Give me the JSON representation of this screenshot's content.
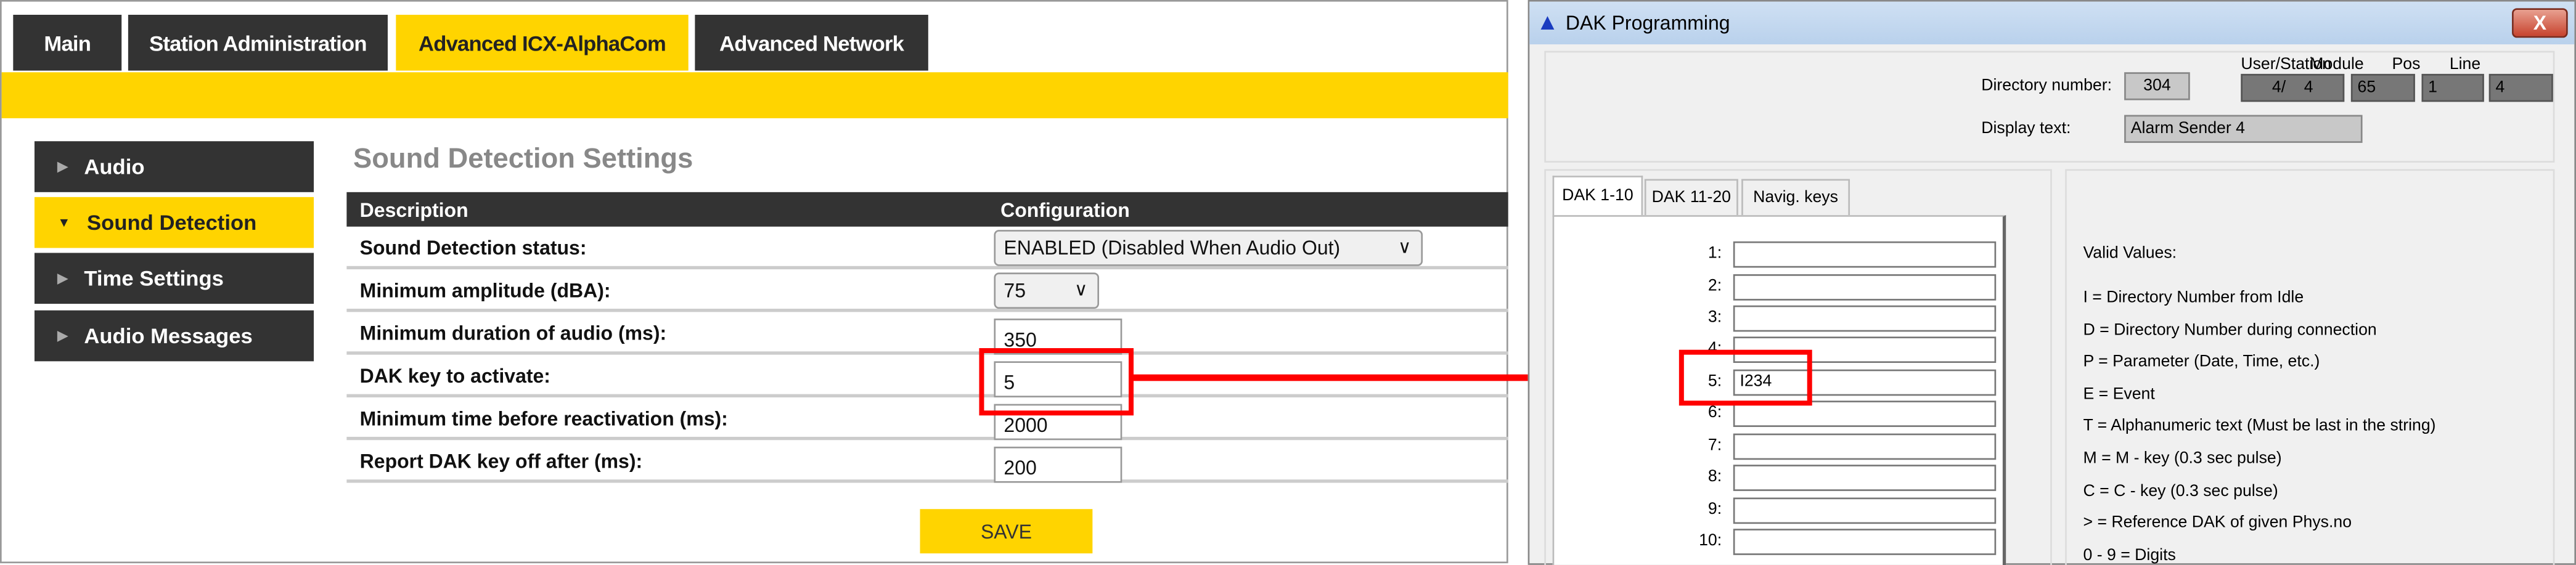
{
  "web": {
    "tabs": [
      "Main",
      "Station Administration",
      "Advanced ICX-AlphaCom",
      "Advanced Network"
    ],
    "sidebar": [
      "Audio",
      "Sound Detection",
      "Time Settings",
      "Audio Messages"
    ],
    "heading": "Sound Detection Settings",
    "table": {
      "headers": [
        "Description",
        "Configuration"
      ],
      "rows": [
        {
          "label": "Sound Detection status:",
          "value": "ENABLED (Disabled When Audio Out)",
          "type": "select"
        },
        {
          "label": "Minimum amplitude (dBA):",
          "value": "75",
          "type": "select"
        },
        {
          "label": "Minimum duration of audio (ms):",
          "value": "350",
          "type": "input"
        },
        {
          "label": "DAK key to activate:",
          "value": "5",
          "type": "input"
        },
        {
          "label": "Minimum time before reactivation (ms):",
          "value": "2000",
          "type": "input"
        },
        {
          "label": "Report DAK key off after (ms):",
          "value": "200",
          "type": "input"
        }
      ]
    },
    "save": "SAVE"
  },
  "dialog": {
    "title": "DAK Programming",
    "close": "X",
    "directory_label": "Directory number:",
    "directory_value": "304",
    "headers": [
      "User/Station",
      "Module",
      "Pos",
      "Line"
    ],
    "values": [
      "4/    4",
      "65",
      "1",
      "4"
    ],
    "display_label": "Display text:",
    "display_value": "Alarm Sender 4",
    "tabs": [
      "DAK 1-10",
      "DAK 11-20",
      "Navig. keys"
    ],
    "keys": [
      {
        "label": "1:",
        "value": ""
      },
      {
        "label": "2:",
        "value": ""
      },
      {
        "label": "3:",
        "value": ""
      },
      {
        "label": "4:",
        "value": ""
      },
      {
        "label": "5:",
        "value": "I234"
      },
      {
        "label": "6:",
        "value": ""
      },
      {
        "label": "7:",
        "value": ""
      },
      {
        "label": "8:",
        "value": ""
      },
      {
        "label": "9:",
        "value": ""
      },
      {
        "label": "10:",
        "value": ""
      }
    ],
    "valid_title": "Valid Values:",
    "valid": [
      "I = Directory Number from Idle",
      "D = Directory Number during connection",
      "P = Parameter (Date, Time, etc.)",
      "E = Event",
      "T = Alphanumeric text (Must be last in the string)",
      "M = M - key (0.3 sec pulse)",
      "C = C - key (0.3 sec pulse)",
      "> = Reference DAK of given Phys.no",
      "0 - 9 = Digits"
    ]
  },
  "colors": {
    "accent": "#ffd400",
    "dark": "#333333",
    "highlight": "#ff0000"
  }
}
